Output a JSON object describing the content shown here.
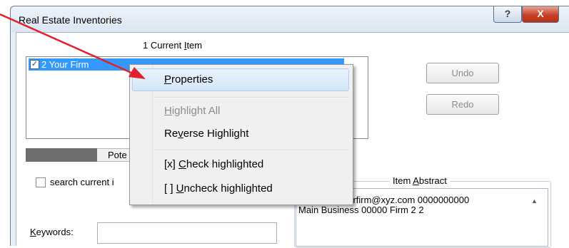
{
  "window": {
    "title": "Real Estate Inventories",
    "help_glyph": "?",
    "close_glyph": "X"
  },
  "items_panel": {
    "label_prefix": "1 Current ",
    "label_mnemonic": "I",
    "label_rest": "tem",
    "list": [
      {
        "checked": true,
        "text": "2 Your Firm",
        "selected": true
      }
    ]
  },
  "buttons": {
    "undo": "Undo",
    "redo": "Redo"
  },
  "tab": {
    "visible_text": "Pote"
  },
  "search": {
    "label": "search current i",
    "checked": false
  },
  "keywords": {
    "mnemonic": "K",
    "rest": "eywords:",
    "value": ""
  },
  "abstract": {
    "label_prefix": "Item ",
    "label_mnemonic": "A",
    "label_rest": "bstract",
    "line1": "Your Firm yourfirm@xyz.com 0000000000",
    "line2": "Main Business 00000 Firm 2 2"
  },
  "context_menu": {
    "properties": {
      "mnemonic": "P",
      "rest": "roperties"
    },
    "highlight_all": {
      "mnemonic": "H",
      "rest": "ighlight All",
      "disabled": true
    },
    "reverse_highlight": {
      "pre": "Re",
      "mnemonic": "v",
      "rest": "erse Highlight"
    },
    "check_highlighted": {
      "pre": "[x] ",
      "mnemonic": "C",
      "rest": "heck highlighted"
    },
    "uncheck_highlighted": {
      "pre": "[ ] ",
      "mnemonic": "U",
      "rest": "ncheck highlighted"
    }
  },
  "colors": {
    "selection": "#3399ff",
    "annotation_arrow": "#e0202a",
    "close_button": "#c54027"
  },
  "icons": {
    "checkbox": "checkbox-checked-icon",
    "scroll_up": "scroll-up-arrow-icon",
    "pointer": "annotation-arrow-icon"
  }
}
